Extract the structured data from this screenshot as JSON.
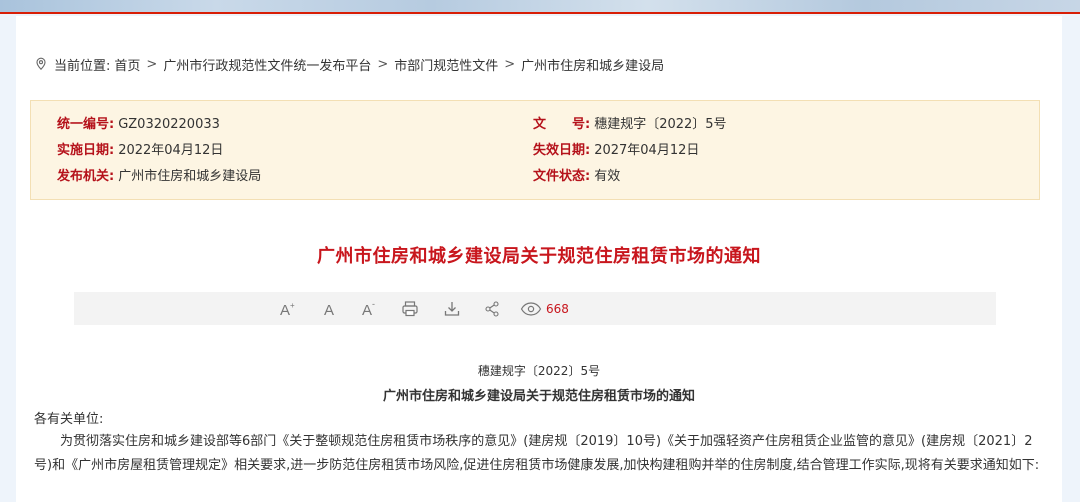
{
  "breadcrumb": {
    "prefix": "当前位置:",
    "items": [
      "首页",
      "广州市行政规范性文件统一发布平台",
      "市部门规范性文件",
      "广州市住房和城乡建设局"
    ],
    "separator": ">"
  },
  "info": {
    "code_label": "统一编号:",
    "code_value": "GZ0320220033",
    "docnum_label": "文　　号:",
    "docnum_value": "穗建规字〔2022〕5号",
    "effective_label": "实施日期:",
    "effective_value": "2022年04月12日",
    "expire_label": "失效日期:",
    "expire_value": "2027年04月12日",
    "issuer_label": "发布机关:",
    "issuer_value": "广州市住房和城乡建设局",
    "status_label": "文件状态:",
    "status_value": "有效"
  },
  "title": "广州市住房和城乡建设局关于规范住房租赁市场的通知",
  "toolbar": {
    "font_large": "A⁺",
    "font_normal": "A",
    "font_small": "A⁻",
    "view_count": "668",
    "icons": [
      "font-increase-icon",
      "font-default-icon",
      "font-decrease-icon",
      "print-icon",
      "download-icon",
      "share-icon",
      "eye-icon"
    ]
  },
  "body": {
    "doc_number": "穗建规字〔2022〕5号",
    "doc_title": "广州市住房和城乡建设局关于规范住房租赁市场的通知",
    "salutation": "各有关单位:",
    "paragraph": "为贯彻落实住房和城乡建设部等6部门《关于整顿规范住房租赁市场秩序的意见》(建房规〔2019〕10号)《关于加强轻资产住房租赁企业监管的意见》(建房规〔2021〕2号)和《广州市房屋租赁管理规定》相关要求,进一步防范住房租赁市场风险,促进住房租赁市场健康发展,加快构建租购并举的住房制度,结合管理工作实际,现将有关要求通知如下:"
  },
  "colors": {
    "accent_red": "#c8161d",
    "label_red": "#b5121b",
    "info_bg": "#fdf5e3",
    "toolbar_bg": "#f3f3f3"
  }
}
